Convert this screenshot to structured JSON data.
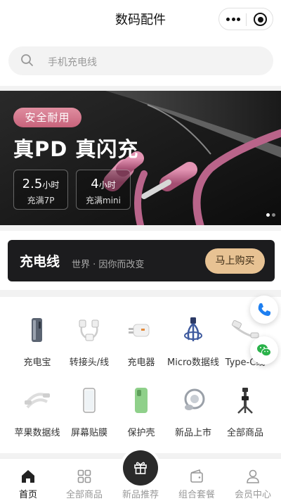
{
  "header": {
    "title": "数码配件"
  },
  "search": {
    "placeholder": "手机充电线"
  },
  "banner": {
    "badge": "安全耐用",
    "headline": "真PD 真闪充",
    "stats": [
      {
        "value": "2.5",
        "unit": "小时",
        "desc": "充满7P"
      },
      {
        "value": "4",
        "unit": "小时",
        "desc": "充满mini"
      }
    ],
    "accent_color": "#c7637b"
  },
  "promo": {
    "title": "充电线",
    "slogan": "世界 · 因你而改变",
    "button": "马上购买",
    "button_color": "#e7c293"
  },
  "categories": [
    {
      "label": "充电宝",
      "icon": "power-bank-icon"
    },
    {
      "label": "转接头/线",
      "icon": "adapter-icon"
    },
    {
      "label": "充电器",
      "icon": "charger-icon"
    },
    {
      "label": "Micro数据线",
      "icon": "micro-cable-icon"
    },
    {
      "label": "Type-C线",
      "icon": "type-c-cable-icon"
    },
    {
      "label": "苹果数据线",
      "icon": "apple-cable-icon"
    },
    {
      "label": "屏幕贴膜",
      "icon": "screen-protector-icon"
    },
    {
      "label": "保护壳",
      "icon": "phone-case-icon"
    },
    {
      "label": "新品上市",
      "icon": "ring-holder-icon"
    },
    {
      "label": "全部商品",
      "icon": "selfie-stick-icon"
    }
  ],
  "floating": {
    "phone_icon": "phone-icon",
    "wechat_icon": "wechat-icon",
    "phone_color": "#1e7ff0",
    "wechat_color": "#2ab24a"
  },
  "tabs": [
    {
      "label": "首页",
      "icon": "home-icon",
      "active": true
    },
    {
      "label": "全部商品",
      "icon": "grid-icon",
      "active": false
    },
    {
      "label": "新品推荐",
      "icon": "gift-icon",
      "active": false
    },
    {
      "label": "组合套餐",
      "icon": "wallet-icon",
      "active": false
    },
    {
      "label": "会员中心",
      "icon": "user-icon",
      "active": false
    }
  ]
}
